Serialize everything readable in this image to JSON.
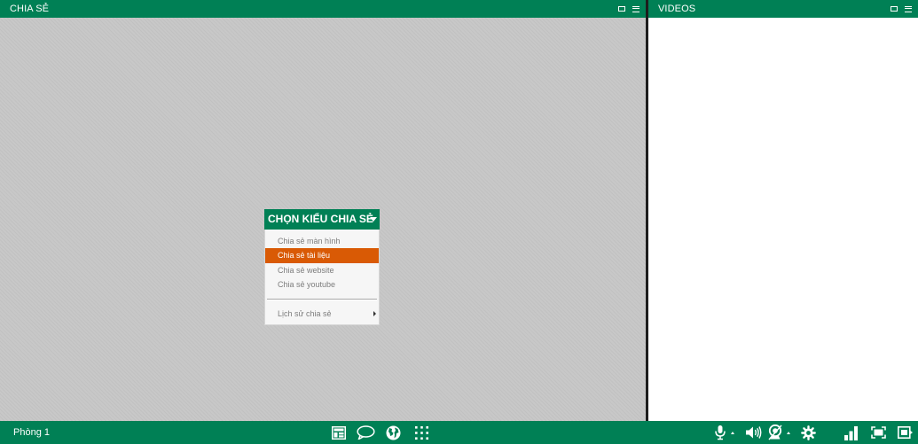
{
  "share_panel": {
    "title": "CHIA SẺ"
  },
  "videos_panel": {
    "title": "VIDEOS"
  },
  "dropdown": {
    "header": "CHỌN KIỂU CHIA SẺ",
    "items": [
      {
        "label": "Chia sẻ màn hình",
        "active": false
      },
      {
        "label": "Chia sẻ tài liệu",
        "active": true
      },
      {
        "label": "Chia sẻ website",
        "active": false
      },
      {
        "label": "Chia sẻ youtube",
        "active": false
      }
    ],
    "history_label": "Lịch sử chia sẻ"
  },
  "footer": {
    "room_label": "Phòng 1",
    "center_icons": [
      "layout-icon",
      "chat-icon",
      "globe-icon",
      "apps-grid-icon"
    ],
    "right_icons": [
      "microphone-icon",
      "speaker-icon",
      "webcam-icon",
      "settings-icon",
      "signal-icon",
      "fullscreen-icon",
      "exit-icon"
    ]
  },
  "colors": {
    "brand_green": "#008055",
    "accent_orange": "#d95a05",
    "canvas_gray": "#c8c8c8"
  }
}
